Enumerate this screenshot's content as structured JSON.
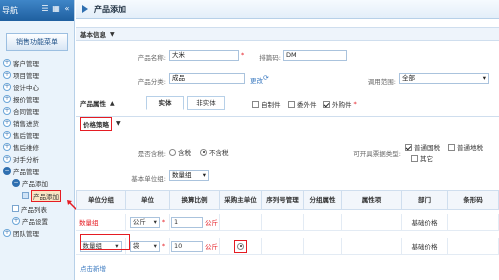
{
  "sidebar": {
    "header_title": "导航",
    "menu_button": "销售功能菜单",
    "items": [
      {
        "label": "客户管理"
      },
      {
        "label": "项目管理"
      },
      {
        "label": "设计中心"
      },
      {
        "label": "报价管理"
      },
      {
        "label": "合同管理"
      },
      {
        "label": "销售进货"
      },
      {
        "label": "售后管理"
      },
      {
        "label": "售后维修"
      },
      {
        "label": "对手分析"
      },
      {
        "label": "产品管理"
      },
      {
        "label": "产品添加"
      },
      {
        "label": "产品添加"
      },
      {
        "label": "产品列表"
      },
      {
        "label": "产品设置"
      },
      {
        "label": "团队管理"
      }
    ]
  },
  "main": {
    "title": "产品添加",
    "basic_info": {
      "section": "基本信息",
      "name_label": "产品名称:",
      "name_value": "大米",
      "code_label": "排篇码:",
      "code_value": "DM",
      "class_label": "产品分类:",
      "class_value": "成品",
      "change_link": "更改",
      "scope_label": "调用范围:",
      "scope_value": "全部"
    },
    "attributes": {
      "label": "产品属性",
      "tab_real": "实体",
      "tab_virtual": "非实体",
      "self_made": "自制件",
      "outsourced": "委外件",
      "purchased": "外购件"
    },
    "pricing": {
      "section": "价格策略",
      "tax_label": "是否含税:",
      "tax_no": "含税",
      "tax_yes": "不含税",
      "invoice_label": "可开具票据类型:",
      "invoice_normal": "普通国税",
      "invoice_local": "普通地税",
      "invoice_other": "其它",
      "unit_label": "基本单位组:",
      "unit_value": "数量组"
    },
    "grid": {
      "headers": [
        "单位分组",
        "单位",
        "换算比例",
        "采购主单位",
        "序列号管理",
        "分组属性",
        "属性项",
        "部门",
        "条形码"
      ],
      "rows": [
        {
          "group": "数量组",
          "unit": "公斤",
          "ratio": "1",
          "ratio_unit": "公斤",
          "dept": "基础价格"
        },
        {
          "group": "数量组",
          "unit": "袋",
          "ratio": "10",
          "ratio_unit": "公斤",
          "dept": "基础价格"
        }
      ],
      "add_link": "点击新增"
    }
  }
}
